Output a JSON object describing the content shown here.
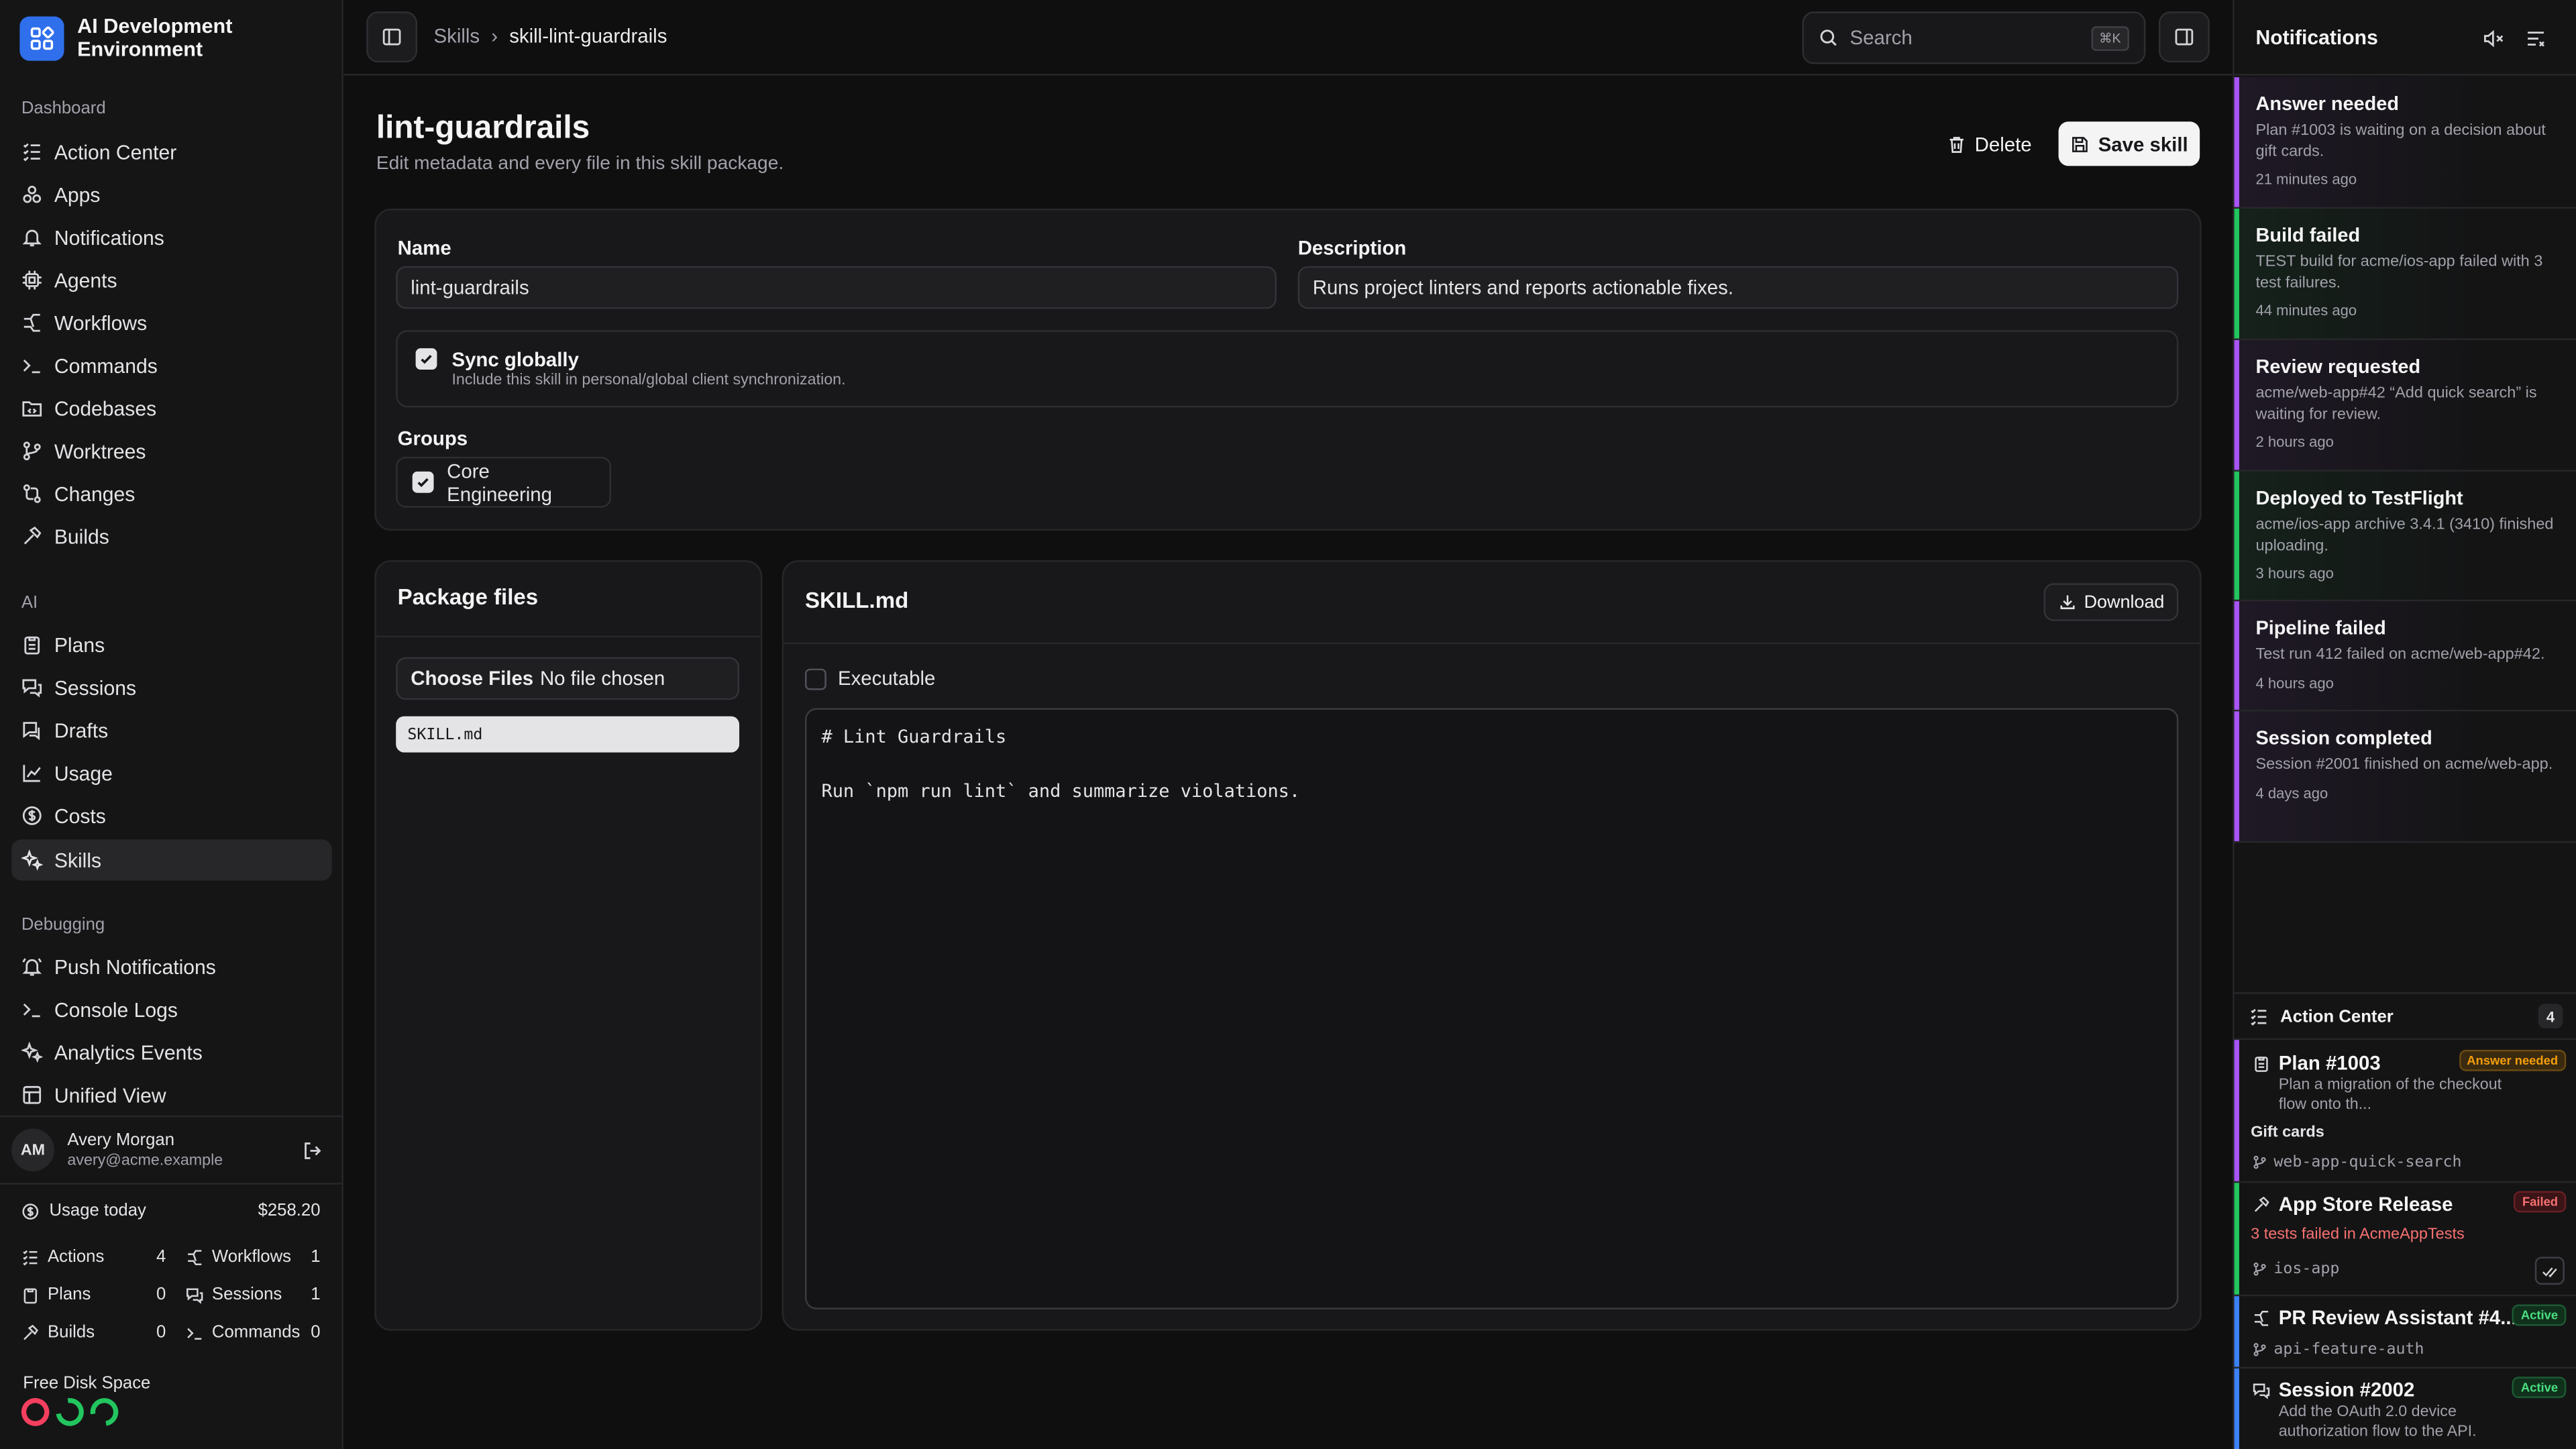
{
  "app": {
    "title": "AI Development Environment"
  },
  "sidebar": {
    "sections": {
      "dashboard": "Dashboard",
      "ai": "AI",
      "debugging": "Debugging"
    },
    "items": {
      "action_center": "Action Center",
      "apps": "Apps",
      "notifications": "Notifications",
      "agents": "Agents",
      "workflows": "Workflows",
      "commands": "Commands",
      "codebases": "Codebases",
      "worktrees": "Worktrees",
      "changes": "Changes",
      "builds": "Builds",
      "plans": "Plans",
      "sessions": "Sessions",
      "drafts": "Drafts",
      "usage": "Usage",
      "costs": "Costs",
      "skills": "Skills",
      "push_notifications": "Push Notifications",
      "console_logs": "Console Logs",
      "analytics_events": "Analytics Events",
      "unified_view": "Unified View"
    },
    "active_item": "skills",
    "user": {
      "initials": "AM",
      "name": "Avery Morgan",
      "email": "avery@acme.example"
    },
    "usage": {
      "label": "Usage today",
      "amount": "$258.20",
      "stats": {
        "actions": {
          "label": "Actions",
          "value": "4"
        },
        "workflows": {
          "label": "Workflows",
          "value": "1"
        },
        "plans": {
          "label": "Plans",
          "value": "0"
        },
        "sessions": {
          "label": "Sessions",
          "value": "1"
        },
        "builds": {
          "label": "Builds",
          "value": "0"
        },
        "commands": {
          "label": "Commands",
          "value": "0"
        }
      }
    },
    "disk": {
      "label": "Free Disk Space",
      "rings": [
        {
          "color": "#f43f5e",
          "level": 0.05
        },
        {
          "color": "#22c55e",
          "level": 0.85
        },
        {
          "color": "#22c55e",
          "level": 0.6
        }
      ]
    }
  },
  "topbar": {
    "breadcrumb": {
      "parent": "Skills",
      "separator": "›",
      "current": "skill-lint-guardrails"
    },
    "search": {
      "placeholder": "Search",
      "shortcut": "⌘K"
    }
  },
  "page": {
    "title": "lint-guardrails",
    "subtitle": "Edit metadata and every file in this skill package.",
    "delete_label": "Delete",
    "save_label": "Save skill"
  },
  "form": {
    "name_label": "Name",
    "name_value": "lint-guardrails",
    "description_label": "Description",
    "description_value": "Runs project linters and reports actionable fixes.",
    "sync_title": "Sync globally",
    "sync_desc": "Include this skill in personal/global client synchronization.",
    "sync_checked": true,
    "groups_label": "Groups",
    "groups": [
      {
        "name": "Core Engineering",
        "checked": true
      }
    ]
  },
  "files": {
    "title": "Package files",
    "choose_label": "Choose Files",
    "no_file": "No file chosen",
    "items": [
      "SKILL.md"
    ]
  },
  "editor": {
    "filename": "SKILL.md",
    "download_label": "Download",
    "executable_label": "Executable",
    "executable_checked": false,
    "content": "# Lint Guardrails\n\nRun `npm run lint` and summarize violations."
  },
  "notifications": {
    "title": "Notifications",
    "items": [
      {
        "title": "Answer needed",
        "body": "Plan #1003 is waiting on a decision about gift cards.",
        "time": "21 minutes ago",
        "color": "#a855f7"
      },
      {
        "title": "Build failed",
        "body": "TEST build for acme/ios-app failed with 3 test failures.",
        "time": "44 minutes ago",
        "color": "#22c55e"
      },
      {
        "title": "Review requested",
        "body": "acme/web-app#42 “Add quick search” is waiting for review.",
        "time": "2 hours ago",
        "color": "#a855f7"
      },
      {
        "title": "Deployed to TestFlight",
        "body": "acme/ios-app archive 3.4.1 (3410) finished uploading.",
        "time": "3 hours ago",
        "color": "#22c55e"
      },
      {
        "title": "Pipeline failed",
        "body": "Test run 412 failed on acme/web-app#42.",
        "time": "4 hours ago",
        "color": "#a855f7"
      },
      {
        "title": "Session completed",
        "body": "Session #2001 finished on acme/web-app.",
        "time": "4 days ago",
        "color": "#a855f7"
      }
    ]
  },
  "action_center": {
    "title": "Action Center",
    "count": "4",
    "items": [
      {
        "title": "Plan #1003",
        "badge": "Answer needed",
        "desc": "Plan a migration of the checkout flow onto th...",
        "topic": "Gift cards",
        "branch": "web-app-quick-search",
        "color": "#a855f7"
      },
      {
        "title": "App Store Release",
        "badge": "Failed",
        "desc": "3 tests failed in AcmeAppTests",
        "branch": "ios-app",
        "color": "#22c55e"
      },
      {
        "title": "PR Review Assistant #4...",
        "badge": "Active",
        "branch": "api-feature-auth",
        "color": "#3b82f6"
      },
      {
        "title": "Session #2002",
        "badge": "Active",
        "desc": "Add the OAuth 2.0 device authorization flow to the API.",
        "color": "#3b82f6"
      }
    ]
  }
}
